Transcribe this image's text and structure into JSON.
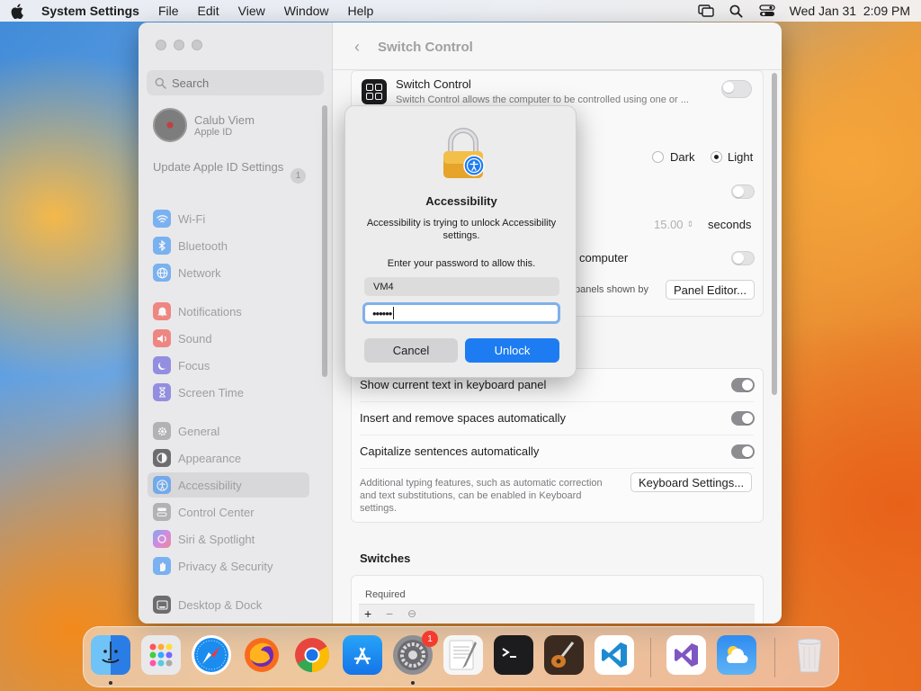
{
  "menubar": {
    "app_name": "System Settings",
    "items": [
      "File",
      "Edit",
      "View",
      "Window",
      "Help"
    ],
    "clock": "Wed Jan 31  2:09 PM"
  },
  "sidebar": {
    "search_placeholder": "Search",
    "account_name": "Calub Viem",
    "account_sub": "Apple ID",
    "update_label": "Update Apple ID Settings",
    "update_badge": "1",
    "items": [
      {
        "label": "Wi-Fi",
        "icon": "wifi-icon",
        "color": "#2f8cf5"
      },
      {
        "label": "Bluetooth",
        "icon": "bluetooth-icon",
        "color": "#2f8cf5"
      },
      {
        "label": "Network",
        "icon": "globe-icon",
        "color": "#2f8cf5"
      },
      {
        "label": "Notifications",
        "icon": "bell-icon",
        "color": "#f2463b"
      },
      {
        "label": "Sound",
        "icon": "speaker-icon",
        "color": "#f2463b"
      },
      {
        "label": "Focus",
        "icon": "moon-icon",
        "color": "#5b53d8"
      },
      {
        "label": "Screen Time",
        "icon": "hourglass-icon",
        "color": "#5b53d8"
      },
      {
        "label": "General",
        "icon": "gear-icon",
        "color": "#8e8e93"
      },
      {
        "label": "Appearance",
        "icon": "appearance-icon",
        "color": "#1c1c1e"
      },
      {
        "label": "Accessibility",
        "icon": "accessibility-icon",
        "color": "#2f8cf5"
      },
      {
        "label": "Control Center",
        "icon": "control-center-icon",
        "color": "#8e8e93"
      },
      {
        "label": "Siri & Spotlight",
        "icon": "siri-icon",
        "color": "#c04fd8"
      },
      {
        "label": "Privacy & Security",
        "icon": "hand-icon",
        "color": "#2f8cf5"
      },
      {
        "label": "Desktop & Dock",
        "icon": "dock-icon",
        "color": "#1c1c1e"
      }
    ]
  },
  "content": {
    "title": "Switch Control",
    "switch_control_title": "Switch Control",
    "switch_control_desc": "Switch Control allows the computer to be controlled using one or ... keyboard, gamepad buttons",
    "dark_label": "Dark",
    "light_label": "Light",
    "seconds_value": "15.00",
    "seconds_label": "seconds",
    "computer_label": "computer",
    "panels_label": "panels shown by",
    "panel_editor_button": "Panel Editor...",
    "show_current_text": "Show current text in keyboard panel",
    "insert_remove_spaces": "Insert and remove spaces automatically",
    "capitalize_sentences": "Capitalize sentences automatically",
    "typing_note": "Additional typing features, such as automatic correction and text substitutions, can be enabled in Keyboard settings.",
    "keyboard_settings_button": "Keyboard Settings...",
    "switches_title": "Switches",
    "required_label": "Required"
  },
  "dialog": {
    "title": "Accessibility",
    "message": "Accessibility is trying to unlock Accessibility settings.",
    "prompt": "Enter your password to allow this.",
    "username": "VM4",
    "password_mask": "••••••",
    "cancel_label": "Cancel",
    "unlock_label": "Unlock"
  },
  "dock": {
    "apps": [
      "Finder",
      "Launchpad",
      "Safari",
      "Firefox",
      "Chrome",
      "App Store",
      "System Settings",
      "TextEdit",
      "Terminal",
      "Instruments",
      "Visual Studio Code",
      "Visual Studio",
      "Weather",
      "Trash"
    ],
    "settings_badge": "1"
  }
}
